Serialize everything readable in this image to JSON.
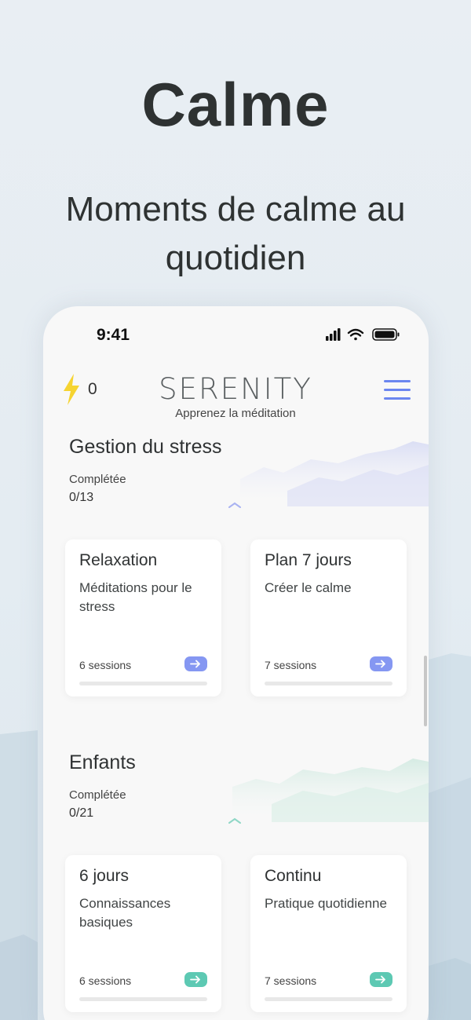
{
  "hero": {
    "title": "Calme",
    "subtitle": "Moments de calme au quotidien"
  },
  "status_bar": {
    "time": "9:41"
  },
  "app_bar": {
    "energy_count": "0",
    "logo": "SERENITY",
    "tagline": "Apprenez la méditation"
  },
  "sections": [
    {
      "title": "Gestion du stress",
      "completed_label": "Complétée",
      "completed_count": "0/13",
      "accent": "#8597f2",
      "cards": [
        {
          "title": "Relaxation",
          "description": "Méditations pour le stress",
          "sessions": "6 sessions",
          "progress": 0
        },
        {
          "title": "Plan 7 jours",
          "description": "Créer le calme",
          "sessions": "7 sessions",
          "progress": 0
        }
      ]
    },
    {
      "title": "Enfants",
      "completed_label": "Complétée",
      "completed_count": "0/21",
      "accent": "#5dc9b3",
      "cards": [
        {
          "title": "6 jours",
          "description": "Connaissances basiques",
          "sessions": "6 sessions",
          "progress": 0
        },
        {
          "title": "Continu",
          "description": "Pratique quotidienne",
          "sessions": "7 sessions",
          "progress": 0
        }
      ]
    }
  ],
  "colors": {
    "menu_icon": "#6b86f0",
    "bolt_icon": "#f6d431",
    "background": "#e6edf2"
  }
}
